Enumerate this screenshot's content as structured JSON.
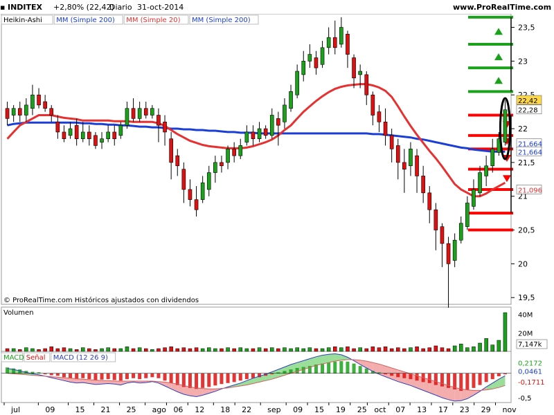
{
  "header": {
    "symbol": "INDITEX",
    "change": "+2,80% (22,42)",
    "period": "Diario",
    "date": "31-oct-2014",
    "site": "www.ProRealTime.com"
  },
  "colors": {
    "up": "#1aa31a",
    "down": "#e01010",
    "sma200": "#1a3ed6",
    "sma20": "#e83030",
    "macd_line": "#3040c0",
    "signal_line": "#d06060",
    "green_level": "#1aa31a",
    "red_level": "#ff0000"
  },
  "chart_data": [
    {
      "panel": "price",
      "type": "candlestick",
      "legend": [
        "Heikin-Ashi",
        "MM (Simple 200)",
        "MM (Simple 20)",
        "MM (Simple 200)"
      ],
      "x_tick_labels": [
        "jul",
        "09",
        "15",
        "21",
        "25",
        "ago",
        "06",
        "12",
        "18",
        "22",
        "sep",
        "09",
        "15",
        "19",
        "25",
        "oct",
        "07",
        "13",
        "17",
        "23",
        "29",
        "nov"
      ],
      "y_tick_labels": [
        "19,5",
        "20",
        "20,5",
        "21",
        "21,5",
        "22",
        "22,5",
        "23",
        "23,5"
      ],
      "ylim": [
        19.4,
        23.7
      ],
      "price_labels": {
        "last": "22,42",
        "ref": "22,28",
        "sma200_a": "21,664",
        "sma200_b": "21,664",
        "sma20": "21,096"
      },
      "footer": "© ProRealTime.com Históricos ajustados con dividendos",
      "sma20": [
        21.85,
        21.95,
        22.05,
        22.1,
        22.15,
        22.2,
        22.2,
        22.2,
        22.18,
        22.16,
        22.15,
        22.14,
        22.12,
        22.12,
        22.12,
        22.12,
        22.12,
        22.11,
        22.11,
        22.11,
        22.1,
        22.1,
        22.1,
        22.1,
        22.08,
        22.04,
        21.98,
        21.92,
        21.87,
        21.82,
        21.79,
        21.76,
        21.74,
        21.73,
        21.72,
        21.71,
        21.71,
        21.71,
        21.72,
        21.74,
        21.77,
        21.8,
        21.84,
        21.9,
        21.98,
        22.05,
        22.15,
        22.25,
        22.33,
        22.41,
        22.48,
        22.54,
        22.59,
        22.62,
        22.64,
        22.65,
        22.66,
        22.66,
        22.64,
        22.61,
        22.56,
        22.47,
        22.33,
        22.18,
        22.04,
        21.91,
        21.79,
        21.67,
        21.56,
        21.44,
        21.31,
        21.18,
        21.1,
        21.05,
        21.0,
        21.0,
        21.04,
        21.1,
        21.15,
        21.2
      ],
      "sma200": [
        22.05,
        22.07,
        22.08,
        22.09,
        22.09,
        22.09,
        22.09,
        22.09,
        22.09,
        22.09,
        22.09,
        22.09,
        22.08,
        22.08,
        22.07,
        22.07,
        22.06,
        22.06,
        22.05,
        22.05,
        22.04,
        22.03,
        22.03,
        22.02,
        22.02,
        22.01,
        22.0,
        22.0,
        21.99,
        21.99,
        21.98,
        21.98,
        21.97,
        21.97,
        21.96,
        21.95,
        21.95,
        21.94,
        21.94,
        21.94,
        21.93,
        21.93,
        21.93,
        21.93,
        21.93,
        21.93,
        21.93,
        21.93,
        21.93,
        21.93,
        21.93,
        21.93,
        21.93,
        21.93,
        21.93,
        21.93,
        21.93,
        21.93,
        21.92,
        21.92,
        21.91,
        21.9,
        21.89,
        21.88,
        21.87,
        21.85,
        21.84,
        21.82,
        21.8,
        21.78,
        21.76,
        21.74,
        21.72,
        21.71,
        21.69,
        21.68,
        21.67,
        21.66,
        21.66,
        21.66
      ],
      "candles": [
        {
          "o": 22.3,
          "c": 22.15,
          "h": 22.4,
          "l": 22.05
        },
        {
          "o": 22.2,
          "c": 22.3,
          "h": 22.35,
          "l": 22.1
        },
        {
          "o": 22.3,
          "c": 22.2,
          "h": 22.4,
          "l": 22.1
        },
        {
          "o": 22.2,
          "c": 22.35,
          "h": 22.45,
          "l": 22.1
        },
        {
          "o": 22.3,
          "c": 22.5,
          "h": 22.65,
          "l": 22.2
        },
        {
          "o": 22.5,
          "c": 22.35,
          "h": 22.6,
          "l": 22.3
        },
        {
          "o": 22.4,
          "c": 22.3,
          "h": 22.5,
          "l": 22.25
        },
        {
          "o": 22.3,
          "c": 22.2,
          "h": 22.35,
          "l": 22.1
        },
        {
          "o": 22.1,
          "c": 21.95,
          "h": 22.2,
          "l": 21.85
        },
        {
          "o": 21.95,
          "c": 21.85,
          "h": 22.05,
          "l": 21.8
        },
        {
          "o": 21.9,
          "c": 22.0,
          "h": 22.1,
          "l": 21.85
        },
        {
          "o": 22.05,
          "c": 21.85,
          "h": 22.15,
          "l": 21.75
        },
        {
          "o": 21.85,
          "c": 21.95,
          "h": 22.1,
          "l": 21.8
        },
        {
          "o": 21.95,
          "c": 21.85,
          "h": 22.05,
          "l": 21.75
        },
        {
          "o": 21.9,
          "c": 21.75,
          "h": 21.95,
          "l": 21.7
        },
        {
          "o": 21.8,
          "c": 21.85,
          "h": 21.95,
          "l": 21.7
        },
        {
          "o": 21.85,
          "c": 21.95,
          "h": 22.05,
          "l": 21.8
        },
        {
          "o": 21.95,
          "c": 21.85,
          "h": 22.05,
          "l": 21.75
        },
        {
          "o": 21.9,
          "c": 22.05,
          "h": 22.1,
          "l": 21.85
        },
        {
          "o": 22.05,
          "c": 22.3,
          "h": 22.4,
          "l": 22.0
        },
        {
          "o": 22.3,
          "c": 22.15,
          "h": 22.45,
          "l": 22.1
        },
        {
          "o": 22.15,
          "c": 22.3,
          "h": 22.4,
          "l": 22.1
        },
        {
          "o": 22.3,
          "c": 22.2,
          "h": 22.4,
          "l": 22.15
        },
        {
          "o": 22.2,
          "c": 22.3,
          "h": 22.35,
          "l": 22.15
        },
        {
          "o": 22.2,
          "c": 22.05,
          "h": 22.3,
          "l": 21.8
        },
        {
          "o": 22.1,
          "c": 21.95,
          "h": 22.2,
          "l": 21.75
        },
        {
          "o": 21.85,
          "c": 21.5,
          "h": 21.95,
          "l": 21.25
        },
        {
          "o": 21.6,
          "c": 21.45,
          "h": 21.7,
          "l": 21.3
        },
        {
          "o": 21.4,
          "c": 21.1,
          "h": 21.5,
          "l": 20.9
        },
        {
          "o": 21.1,
          "c": 20.95,
          "h": 21.25,
          "l": 20.85
        },
        {
          "o": 20.95,
          "c": 20.8,
          "h": 21.15,
          "l": 20.7
        },
        {
          "o": 20.95,
          "c": 21.2,
          "h": 21.3,
          "l": 20.9
        },
        {
          "o": 21.1,
          "c": 21.35,
          "h": 21.45,
          "l": 21.0
        },
        {
          "o": 21.35,
          "c": 21.5,
          "h": 21.6,
          "l": 21.2
        },
        {
          "o": 21.5,
          "c": 21.45,
          "h": 21.6,
          "l": 21.35
        },
        {
          "o": 21.5,
          "c": 21.7,
          "h": 21.75,
          "l": 21.4
        },
        {
          "o": 21.7,
          "c": 21.6,
          "h": 21.8,
          "l": 21.5
        },
        {
          "o": 21.6,
          "c": 21.75,
          "h": 21.85,
          "l": 21.55
        },
        {
          "o": 21.8,
          "c": 21.95,
          "h": 22.05,
          "l": 21.75
        },
        {
          "o": 21.95,
          "c": 21.85,
          "h": 22.05,
          "l": 21.75
        },
        {
          "o": 21.85,
          "c": 22.0,
          "h": 22.1,
          "l": 21.8
        },
        {
          "o": 22.0,
          "c": 21.9,
          "h": 22.05,
          "l": 21.85
        },
        {
          "o": 21.9,
          "c": 22.2,
          "h": 22.3,
          "l": 21.85
        },
        {
          "o": 22.15,
          "c": 22.05,
          "h": 22.25,
          "l": 21.75
        },
        {
          "o": 22.1,
          "c": 22.35,
          "h": 22.45,
          "l": 22.0
        },
        {
          "o": 22.3,
          "c": 22.55,
          "h": 22.65,
          "l": 22.25
        },
        {
          "o": 22.5,
          "c": 22.85,
          "h": 22.95,
          "l": 22.45
        },
        {
          "o": 22.8,
          "c": 23.0,
          "h": 23.15,
          "l": 22.7
        },
        {
          "o": 23.0,
          "c": 23.1,
          "h": 23.25,
          "l": 22.9
        },
        {
          "o": 23.05,
          "c": 22.9,
          "h": 23.15,
          "l": 22.8
        },
        {
          "o": 22.95,
          "c": 23.2,
          "h": 23.3,
          "l": 22.9
        },
        {
          "o": 23.2,
          "c": 23.35,
          "h": 23.5,
          "l": 23.1
        },
        {
          "o": 23.35,
          "c": 23.2,
          "h": 23.6,
          "l": 23.1
        },
        {
          "o": 23.25,
          "c": 23.5,
          "h": 23.65,
          "l": 23.2
        },
        {
          "o": 23.4,
          "c": 23.1,
          "h": 23.45,
          "l": 22.9
        },
        {
          "o": 23.05,
          "c": 22.75,
          "h": 23.1,
          "l": 22.6
        },
        {
          "o": 22.8,
          "c": 22.85,
          "h": 22.95,
          "l": 22.6
        },
        {
          "o": 22.8,
          "c": 22.5,
          "h": 22.85,
          "l": 22.35
        },
        {
          "o": 22.5,
          "c": 22.2,
          "h": 22.55,
          "l": 22.05
        },
        {
          "o": 22.25,
          "c": 22.1,
          "h": 22.35,
          "l": 21.95
        },
        {
          "o": 22.1,
          "c": 21.9,
          "h": 22.3,
          "l": 21.75
        },
        {
          "o": 21.9,
          "c": 21.7,
          "h": 22.0,
          "l": 21.5
        },
        {
          "o": 21.75,
          "c": 21.5,
          "h": 21.85,
          "l": 21.25
        },
        {
          "o": 21.5,
          "c": 21.4,
          "h": 21.7,
          "l": 21.05
        },
        {
          "o": 21.45,
          "c": 21.7,
          "h": 21.8,
          "l": 21.3
        },
        {
          "o": 21.6,
          "c": 21.3,
          "h": 21.7,
          "l": 21.05
        },
        {
          "o": 21.3,
          "c": 21.05,
          "h": 21.45,
          "l": 20.9
        },
        {
          "o": 21.05,
          "c": 20.8,
          "h": 21.15,
          "l": 20.6
        },
        {
          "o": 20.8,
          "c": 20.5,
          "h": 20.9,
          "l": 20.2
        },
        {
          "o": 20.55,
          "c": 20.3,
          "h": 20.6,
          "l": 19.95
        },
        {
          "o": 20.3,
          "c": 20.0,
          "h": 20.4,
          "l": 19.35
        },
        {
          "o": 20.05,
          "c": 20.35,
          "h": 20.45,
          "l": 19.95
        },
        {
          "o": 20.35,
          "c": 20.6,
          "h": 20.7,
          "l": 20.3
        },
        {
          "o": 20.55,
          "c": 20.9,
          "h": 21.0,
          "l": 20.5
        },
        {
          "o": 20.85,
          "c": 21.1,
          "h": 21.25,
          "l": 20.8
        },
        {
          "o": 21.05,
          "c": 21.35,
          "h": 21.45,
          "l": 21.0
        },
        {
          "o": 21.3,
          "c": 21.45,
          "h": 21.6,
          "l": 21.15
        },
        {
          "o": 21.45,
          "c": 21.7,
          "h": 21.85,
          "l": 21.35
        },
        {
          "o": 21.65,
          "c": 21.85,
          "h": 21.95,
          "l": 21.6
        },
        {
          "o": 21.8,
          "c": 22.28,
          "h": 22.42,
          "l": 21.75
        }
      ]
    },
    {
      "panel": "volume",
      "type": "bar",
      "label": "Volumen",
      "y_tick_labels": [
        "40M",
        "20M"
      ],
      "last_label": "7,147k",
      "ylim": [
        0,
        45
      ],
      "units": "M",
      "values": [
        3,
        3,
        2,
        4,
        3,
        2,
        3,
        5,
        3,
        4,
        3,
        2,
        4,
        3,
        2,
        3,
        4,
        3,
        3,
        5,
        3,
        4,
        3,
        2,
        3,
        4,
        5,
        3,
        4,
        3,
        4,
        3,
        4,
        3,
        3,
        4,
        3,
        4,
        3,
        3,
        4,
        3,
        4,
        3,
        4,
        3,
        4,
        3,
        4,
        3,
        3,
        4,
        5,
        4,
        5,
        3,
        4,
        3,
        5,
        4,
        5,
        3,
        4,
        3,
        4,
        5,
        3,
        4,
        6,
        4,
        3,
        6,
        8,
        4,
        5,
        9,
        14,
        7,
        12,
        42,
        8,
        30,
        7
      ]
    },
    {
      "panel": "macd",
      "type": "histogram",
      "legend": [
        "MACD",
        "Señal",
        "MACD (12 26 9)"
      ],
      "y_tick_labels": [
        "0,2172",
        "0,0461",
        "-0,1711",
        "-0,5"
      ],
      "ylim": [
        -0.6,
        0.45
      ],
      "histogram": [
        0.12,
        0.1,
        0.08,
        0.05,
        0.03,
        0.02,
        -0.02,
        -0.04,
        -0.05,
        -0.08,
        -0.1,
        -0.12,
        -0.1,
        -0.12,
        -0.14,
        -0.13,
        -0.12,
        -0.14,
        -0.15,
        -0.12,
        -0.1,
        -0.12,
        -0.1,
        -0.08,
        -0.1,
        -0.15,
        -0.2,
        -0.24,
        -0.28,
        -0.3,
        -0.32,
        -0.3,
        -0.28,
        -0.25,
        -0.22,
        -0.2,
        -0.18,
        -0.15,
        -0.12,
        -0.1,
        -0.08,
        -0.05,
        -0.02,
        0.02,
        0.05,
        0.08,
        0.11,
        0.13,
        0.15,
        0.18,
        0.2,
        0.22,
        0.24,
        0.25,
        0.24,
        0.2,
        0.15,
        0.1,
        0.05,
        0.02,
        -0.02,
        -0.05,
        -0.08,
        -0.1,
        -0.12,
        -0.15,
        -0.18,
        -0.2,
        -0.24,
        -0.27,
        -0.3,
        -0.33,
        -0.36,
        -0.34,
        -0.3,
        -0.24,
        -0.18,
        -0.12,
        -0.06,
        -0.02,
        0.04,
        0.08,
        0.12,
        0.16,
        0.2,
        0.22
      ],
      "macd": [
        0.1,
        0.08,
        0.05,
        0.02,
        -0.01,
        -0.03,
        -0.06,
        -0.09,
        -0.12,
        -0.15,
        -0.18,
        -0.2,
        -0.19,
        -0.21,
        -0.23,
        -0.22,
        -0.21,
        -0.22,
        -0.24,
        -0.2,
        -0.18,
        -0.2,
        -0.19,
        -0.17,
        -0.2,
        -0.26,
        -0.32,
        -0.38,
        -0.43,
        -0.46,
        -0.48,
        -0.45,
        -0.41,
        -0.37,
        -0.32,
        -0.28,
        -0.24,
        -0.2,
        -0.15,
        -0.1,
        -0.06,
        -0.02,
        0.03,
        0.08,
        0.13,
        0.18,
        0.22,
        0.26,
        0.3,
        0.34,
        0.37,
        0.39,
        0.4,
        0.38,
        0.33,
        0.26,
        0.18,
        0.11,
        0.04,
        -0.02,
        -0.07,
        -0.12,
        -0.17,
        -0.21,
        -0.25,
        -0.3,
        -0.35,
        -0.4,
        -0.45,
        -0.5,
        -0.54,
        -0.57,
        -0.56,
        -0.52,
        -0.45,
        -0.37,
        -0.28,
        -0.2,
        -0.12,
        -0.05,
        0.02,
        0.08,
        0.14,
        0.2,
        0.24,
        0.22
      ],
      "signal": [
        0.0,
        -0.01,
        -0.02,
        -0.03,
        -0.04,
        -0.05,
        -0.06,
        -0.07,
        -0.08,
        -0.09,
        -0.1,
        -0.11,
        -0.12,
        -0.13,
        -0.14,
        -0.15,
        -0.15,
        -0.16,
        -0.16,
        -0.16,
        -0.16,
        -0.16,
        -0.16,
        -0.16,
        -0.17,
        -0.18,
        -0.2,
        -0.22,
        -0.25,
        -0.28,
        -0.3,
        -0.31,
        -0.32,
        -0.32,
        -0.31,
        -0.3,
        -0.28,
        -0.26,
        -0.24,
        -0.21,
        -0.18,
        -0.15,
        -0.12,
        -0.08,
        -0.04,
        0.0,
        0.04,
        0.08,
        0.12,
        0.16,
        0.19,
        0.22,
        0.25,
        0.27,
        0.28,
        0.28,
        0.27,
        0.25,
        0.22,
        0.19,
        0.15,
        0.11,
        0.07,
        0.03,
        -0.01,
        -0.05,
        -0.09,
        -0.13,
        -0.17,
        -0.21,
        -0.25,
        -0.29,
        -0.32,
        -0.34,
        -0.35,
        -0.35,
        -0.34,
        -0.32,
        -0.29,
        -0.25,
        -0.21,
        -0.16,
        -0.11,
        -0.06,
        -0.02,
        0.05
      ]
    }
  ],
  "annotations": {
    "green_levels": [
      23.65,
      23.25,
      22.9,
      22.55
    ],
    "red_levels": [
      22.2,
      21.9,
      21.7,
      21.4,
      21.1,
      20.75,
      20.5
    ]
  }
}
